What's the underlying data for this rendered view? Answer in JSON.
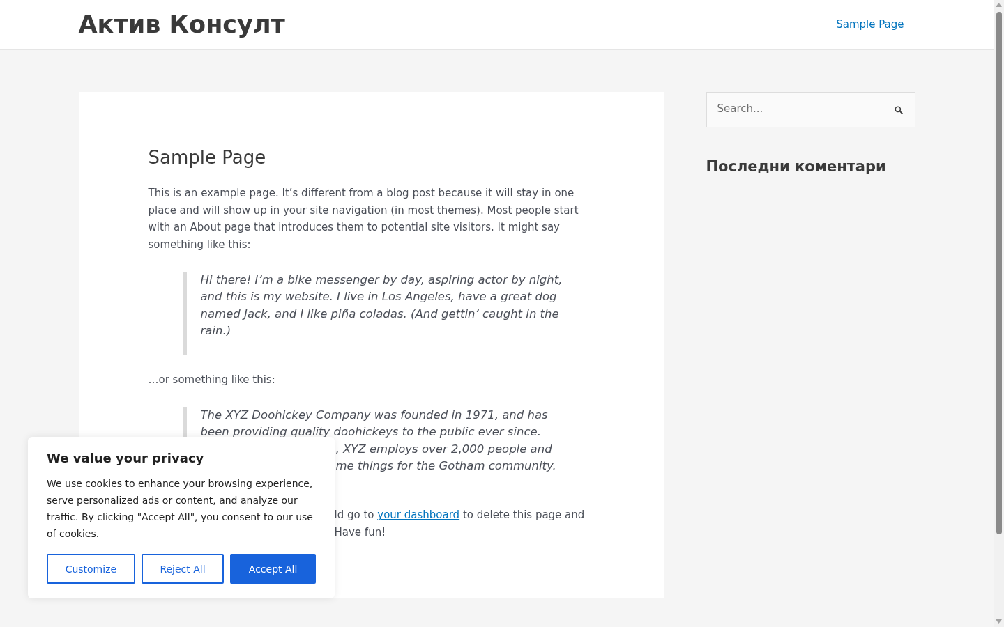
{
  "header": {
    "site_title": "Актив Консулт",
    "nav": [
      {
        "label": "Sample Page"
      }
    ]
  },
  "article": {
    "title": "Sample Page",
    "blocks": [
      {
        "kind": "paragraph",
        "pieces": [
          {
            "text": "This is an example page. It’s different from a blog post because it will stay in one place and will show up in your site navigation (in most themes). Most people start with an About page that introduces them to potential site visitors. It might say something like this:",
            "covered": false
          }
        ]
      },
      {
        "kind": "quote",
        "pieces": [
          {
            "text": "Hi there! I’m a bike messenger by day, aspiring actor by night, and this is my website. I live in Los Angeles, have a great dog named Jack, and I like piña coladas. (And gettin’ caught in the rain.)",
            "covered": false
          }
        ]
      },
      {
        "kind": "paragraph",
        "pieces": [
          {
            "text": "…or something like this:",
            "covered": false
          }
        ]
      },
      {
        "kind": "quote",
        "pieces": [
          {
            "text": "The XYZ Doohickey Company was founded in 1971, and has been providing quality doohickeys to the public ever since.",
            "covered": false
          },
          {
            "text": ", XYZ employs over 2,000 people and",
            "covered": true
          },
          {
            "text": "me things for the Gotham community.",
            "covered": true
          }
        ]
      },
      {
        "kind": "paragraph",
        "pieces": [
          {
            "segments": [
              {
                "text": "ld go to ",
                "link": false
              },
              {
                "text": "your dashboard",
                "link": true
              },
              {
                "text": " to delete this page and",
                "link": false
              }
            ],
            "covered": true
          },
          {
            "text": "Have fun!",
            "covered": true
          }
        ]
      }
    ]
  },
  "sidebar": {
    "search": {
      "placeholder": "Search..."
    },
    "widgets": [
      {
        "title": "Последни коментари"
      }
    ]
  },
  "cookie_banner": {
    "title": "We value your privacy",
    "text": "We use cookies to enhance your browsing experience, serve personalized ads or content, and analyze our traffic. By clicking \"Accept All\", you consent to our use of cookies.",
    "buttons": [
      {
        "label": "Customize",
        "kind": "outline"
      },
      {
        "label": "Reject All",
        "kind": "outline"
      },
      {
        "label": "Accept All",
        "kind": "primary"
      }
    ]
  }
}
